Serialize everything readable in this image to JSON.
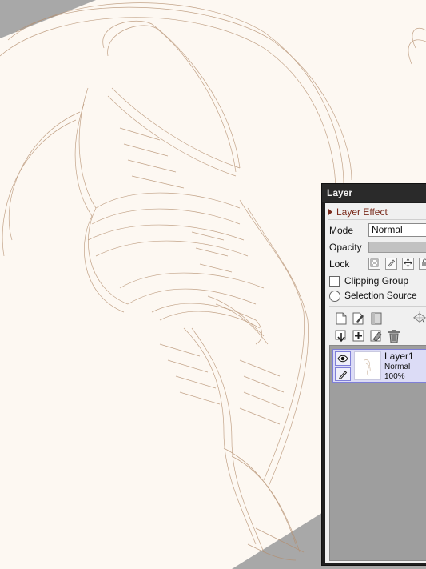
{
  "canvas": {
    "paper_color": "#fdf8f2",
    "sketch_color": "#b48e6e",
    "background_color": "#a8a8a8"
  },
  "layer_panel": {
    "title": "Layer",
    "layer_effect_label": "Layer Effect",
    "mode_label": "Mode",
    "mode_value": "Normal",
    "opacity_label": "Opacity",
    "lock_label": "Lock",
    "lock_icons": [
      "lock-transparency-icon",
      "lock-paint-icon",
      "lock-move-icon",
      "lock-all-icon"
    ],
    "clipping_group_label": "Clipping Group",
    "selection_source_label": "Selection Source",
    "toolbar_icons": [
      "new-layer-icon",
      "new-vector-layer-icon",
      "new-folder-icon",
      "layer-settings-icon",
      "merge-down-icon",
      "merge-visible-icon",
      "clear-layer-icon",
      "delete-layer-icon"
    ],
    "layers": [
      {
        "name": "Layer1",
        "mode": "Normal",
        "opacity": "100%",
        "visible": true
      }
    ]
  }
}
